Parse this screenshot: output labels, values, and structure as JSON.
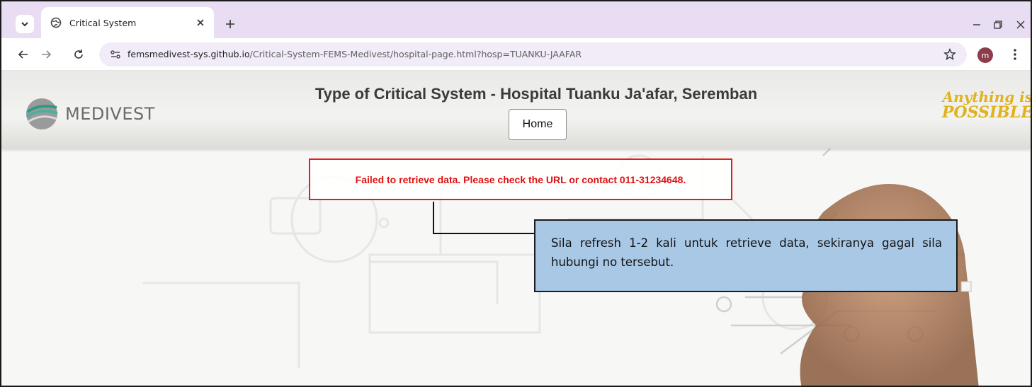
{
  "browser": {
    "tab_title": "Critical System",
    "url_host": "femsmedivest-sys.github.io",
    "url_path": "/Critical-System-FEMS-Medivest/hospital-page.html?hosp=TUANKU-JAAFAR",
    "profile_initial": "m"
  },
  "header": {
    "brand_name": "MEDIVEST",
    "title": "Type of Critical System - Hospital Tuanku Ja'afar, Seremban",
    "home_label": "Home",
    "slogan_line1": "Anything is",
    "slogan_line2": "POSSIBLE"
  },
  "main": {
    "error_message": "Failed to retrieve data. Please check the URL or contact 011-31234648.",
    "callout_text": "Sila refresh 1-2 kali untuk retrieve data, sekiranya gagal sila hubungi no tersebut."
  },
  "colors": {
    "accent_error": "#e01010",
    "callout_bg": "#a9c8e6",
    "slogan": "#e0b21f"
  },
  "icons": [
    "tab-search-icon",
    "globe-icon",
    "close-icon",
    "plus-icon",
    "minimize-icon",
    "restore-icon",
    "back-icon",
    "forward-icon",
    "reload-icon",
    "site-info-icon",
    "star-icon",
    "kebab-icon"
  ]
}
